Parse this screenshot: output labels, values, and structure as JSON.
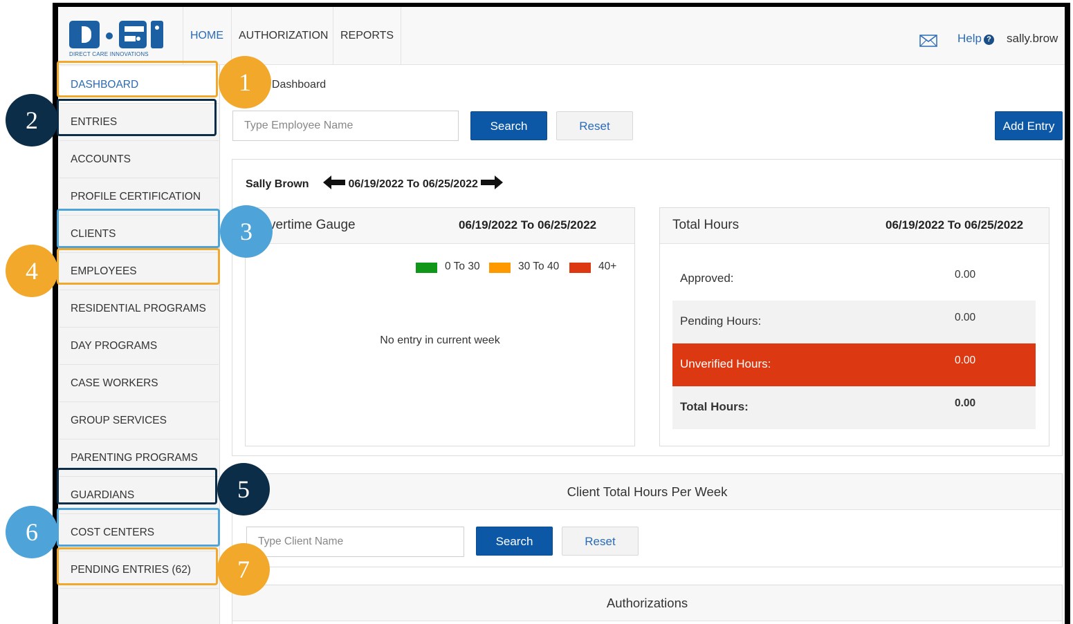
{
  "colors": {
    "accent_blue": "#0c57a6",
    "link_blue": "#2a6bb5",
    "callout_orange": "#f2a82a",
    "callout_navy": "#0b2d47",
    "callout_blue": "#4ea3d9",
    "unverified_red": "#dc3912",
    "legend_green": "#109618",
    "legend_orange": "#ff9900",
    "legend_red": "#dc3912"
  },
  "topnav": {
    "logo_text": "DIRECT CARE INNOVATIONS",
    "links": [
      "HOME",
      "AUTHORIZATION",
      "REPORTS"
    ],
    "help_label": "Help",
    "user_label": "sally.brow"
  },
  "sidebar": {
    "items": [
      "DASHBOARD",
      "ENTRIES",
      "ACCOUNTS",
      "PROFILE CERTIFICATION",
      "CLIENTS",
      "EMPLOYEES",
      "RESIDENTIAL PROGRAMS",
      "DAY PROGRAMS",
      "CASE WORKERS",
      "GROUP SERVICES",
      "PARENTING PROGRAMS",
      "GUARDIANS",
      "COST CENTERS",
      "PENDING ENTRIES (62)"
    ]
  },
  "breadcrumb": "/ Dashboard",
  "employee_search": {
    "placeholder": "Type Employee Name",
    "search_label": "Search",
    "reset_label": "Reset",
    "add_entry_label": "Add Entry"
  },
  "week": {
    "employee_name": "Sally Brown",
    "range": "06/19/2022 To 06/25/2022"
  },
  "overtime_gauge": {
    "title": "vertime Gauge",
    "range": "06/19/2022 To 06/25/2022",
    "legend": [
      "0 To 30",
      "30 To 40",
      "40+"
    ],
    "empty_message": "No entry in current week"
  },
  "total_hours": {
    "title": "Total Hours",
    "range": "06/19/2022 To 06/25/2022",
    "rows": [
      {
        "label": "Approved:",
        "value": "0.00"
      },
      {
        "label": "Pending Hours:",
        "value": "0.00"
      },
      {
        "label": "Unverified Hours:",
        "value": "0.00"
      },
      {
        "label": "Total Hours:",
        "value": "0.00"
      }
    ]
  },
  "client_hours": {
    "title": "Client Total Hours Per Week",
    "placeholder": "Type Client Name",
    "search_label": "Search",
    "reset_label": "Reset"
  },
  "authorizations": {
    "title": "Authorizations"
  },
  "callouts": [
    "1",
    "2",
    "3",
    "4",
    "5",
    "6",
    "7"
  ]
}
